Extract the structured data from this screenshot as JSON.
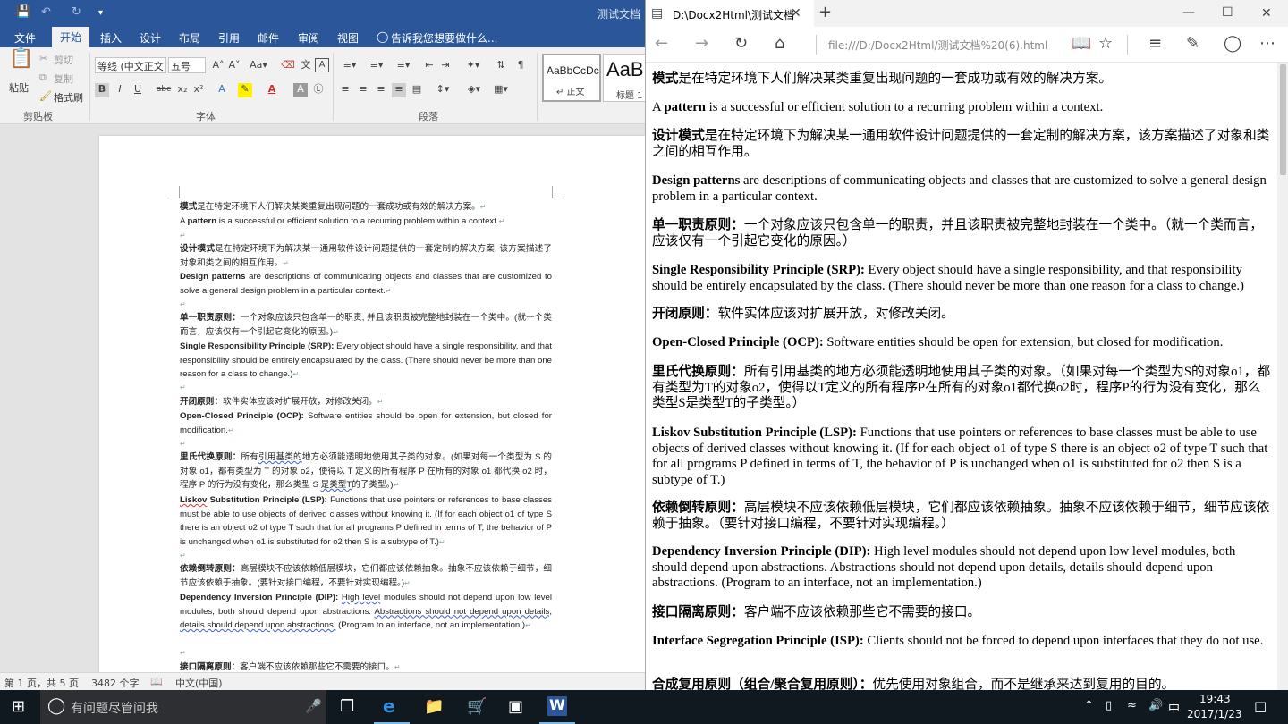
{
  "word": {
    "title": "测试文档",
    "tabs": [
      "文件",
      "开始",
      "插入",
      "设计",
      "布局",
      "引用",
      "邮件",
      "审阅",
      "视图"
    ],
    "active_tab": "开始",
    "tell_me": "告诉我您想要做什么...",
    "clipboard": {
      "paste": "粘贴",
      "cut": "剪切",
      "copy": "复制",
      "format_painter": "格式刷",
      "group": "剪贴板"
    },
    "font": {
      "name": "等线 (中文正文",
      "size": "五号",
      "group": "字体"
    },
    "paragraph": {
      "group": "段落"
    },
    "styles": [
      {
        "preview": "AaBbCcDc",
        "label": "↵ 正文"
      },
      {
        "preview": "AaB",
        "label": "标题 1"
      }
    ],
    "doc_lines": {
      "l1": {
        "bold": "模式",
        "text": "是在特定环境下人们解决某类重复出现问题的一套成功或有效的解决方案。"
      },
      "l2": {
        "pre": "A ",
        "bold": "pattern",
        "text": " is a successful or efficient solution to a recurring problem within a context."
      },
      "l3": {
        "bold": "设计模式",
        "text": "是在特定环境下为解决某一通用软件设计问题提供的一套定制的解决方案, 该方案描述了对象和类之间的相互作用。"
      },
      "l4": {
        "bold": "Design patterns",
        "text": " are descriptions of communicating objects and classes that are customized to solve a general design problem in a particular context."
      },
      "l5": {
        "bold": "单一职责原则：",
        "text": "一个对象应该只包含单一的职责, 并且该职责被完整地封装在一个类中。(就一个类而言，应该仅有一个引起它变化的原因。)"
      },
      "l6": {
        "bold": "Single Responsibility Principle (SRP):",
        "text": " Every object should have a single responsibility, and that responsibility should be entirely encapsulated by the class. (There should never be more than one reason for a class to change.)"
      },
      "l7": {
        "bold": "开闭原则：",
        "text": "软件实体应该对扩展开放，对修改关闭。"
      },
      "l8": {
        "bold": "Open-Closed Principle (OCP):",
        "text": " Software entities should be open for extension, but closed for modification."
      },
      "l9": {
        "bold": "里氏代换原则：",
        "text_a": "所有",
        "squig_a": "引用基类的",
        "text_b": "地方必须能透明地使用其子类的对象。(如果对每一个类型为 S 的对象 o1，都有类型为 T 的对象 o2，使得以 T 定义的所有程序 P 在所有的对象 o1 都代换 o2 时，程序 P 的行为没有变化，那么类型 S ",
        "squig_b": "是类型T",
        "text_c": "的子类型。)"
      },
      "l10": {
        "squig": "Liskov",
        "bold": " Substitution Principle (LSP):",
        "text": " Functions that use pointers or references to base classes must be able to use objects of derived classes without knowing it. (If for each object o1 of type S there is an object o2 of type T such that for all programs P defined in terms of T, the behavior of P is unchanged when o1 is substituted for o2 then S is a subtype of T.)"
      },
      "l11": {
        "bold": "依赖倒转原则：",
        "text": "高层模块不应该依赖低层模块，它们都应该依赖抽象。抽象不应该依赖于细节，细节应该依赖于抽象。(要针对接口编程，不要针对实现编程。)"
      },
      "l12": {
        "bold": "Dependency Inversion Principle (DIP):",
        "text_a": " ",
        "squig_a": "High level",
        "text_b": " modules should not depend upon low level modules, both should depend upon abstractions. ",
        "squig_b": "Abstractions should not depend upon details, details should depend upon abstractions.",
        "text_c": " (Program to an interface, not an implementation.)"
      },
      "l13": {
        "bold": "接口隔离原则：",
        "text": "客户端不应该依赖那些它不需要的接口。"
      }
    },
    "status": {
      "page": "第 1 页，共 5 页",
      "words": "3482 个字",
      "lang": "中文(中国)"
    }
  },
  "edge": {
    "tab_title": "D:\\Docx2Html\\测试文档",
    "address": "file:///D:/Docx2Html/测试文档%20(6).html",
    "paragraphs": {
      "p1": {
        "bold": "模式",
        "text": "是在特定环境下人们解决某类重复出现问题的一套成功或有效的解决方案。"
      },
      "p2": {
        "pre": "A ",
        "bold": "pattern",
        "text": " is a successful or efficient solution to a recurring problem within a context."
      },
      "p3": {
        "bold": "设计模式",
        "text": "是在特定环境下为解决某一通用软件设计问题提供的一套定制的解决方案，该方案描述了对象和类之间的相互作用。"
      },
      "p4": {
        "bold": "Design patterns",
        "text": " are descriptions of communicating objects and classes that are customized to solve a general design problem in a particular context."
      },
      "p5": {
        "bold": "单一职责原则：",
        "text": "一个对象应该只包含单一的职责，并且该职责被完整地封装在一个类中。（就一个类而言，应该仅有一个引起它变化的原因。）"
      },
      "p6": {
        "bold": "Single Responsibility Principle (SRP):",
        "text": " Every object should have a single responsibility, and that responsibility should be entirely encapsulated by the class. (There should never be more than one reason for a class to change.)"
      },
      "p7": {
        "bold": "开闭原则：",
        "text": "软件实体应该对扩展开放，对修改关闭。"
      },
      "p8": {
        "bold": "Open-Closed Principle (OCP):",
        "text": " Software entities should be open for extension, but closed for modification."
      },
      "p9": {
        "bold": "里氏代换原则：",
        "text": "所有引用基类的地方必须能透明地使用其子类的对象。（如果对每一个类型为S的对象o1，都有类型为T的对象o2，使得以T定义的所有程序P在所有的对象o1都代换o2时，程序P的行为没有变化，那么类型S是类型T的子类型。）"
      },
      "p10": {
        "bold": "Liskov Substitution Principle (LSP):",
        "text": " Functions that use pointers or references to base classes must be able to use objects of derived classes without knowing it. (If for each object o1 of type S there is an object o2 of type T such that for all programs P defined in terms of T, the behavior of P is unchanged when o1 is substituted for o2 then S is a subtype of T.)"
      },
      "p11": {
        "bold": "依赖倒转原则：",
        "text": "高层模块不应该依赖低层模块，它们都应该依赖抽象。抽象不应该依赖于细节，细节应该依赖于抽象。（要针对接口编程，不要针对实现编程。）"
      },
      "p12": {
        "bold": "Dependency Inversion Principle (DIP):",
        "text": " High level modules should not depend upon low level modules, both should depend upon abstractions. Abstractions should not depend upon details, details should depend upon abstractions. (Program to an interface, not an implementation.)"
      },
      "p13": {
        "bold": "接口隔离原则：",
        "text": "客户端不应该依赖那些它不需要的接口。"
      },
      "p14": {
        "bold": "Interface Segregation Principle (ISP):",
        "text": " Clients should not be forced to depend upon interfaces that they do not use."
      },
      "p15": {
        "bold": "合成复用原则（组合/聚合复用原则）：",
        "text": "优先使用对象组合，而不是继承来达到复用的目的。"
      }
    }
  },
  "taskbar": {
    "search_placeholder": "有问题尽管问我",
    "time": "19:43",
    "date": "2017/1/23",
    "ime": "中"
  }
}
